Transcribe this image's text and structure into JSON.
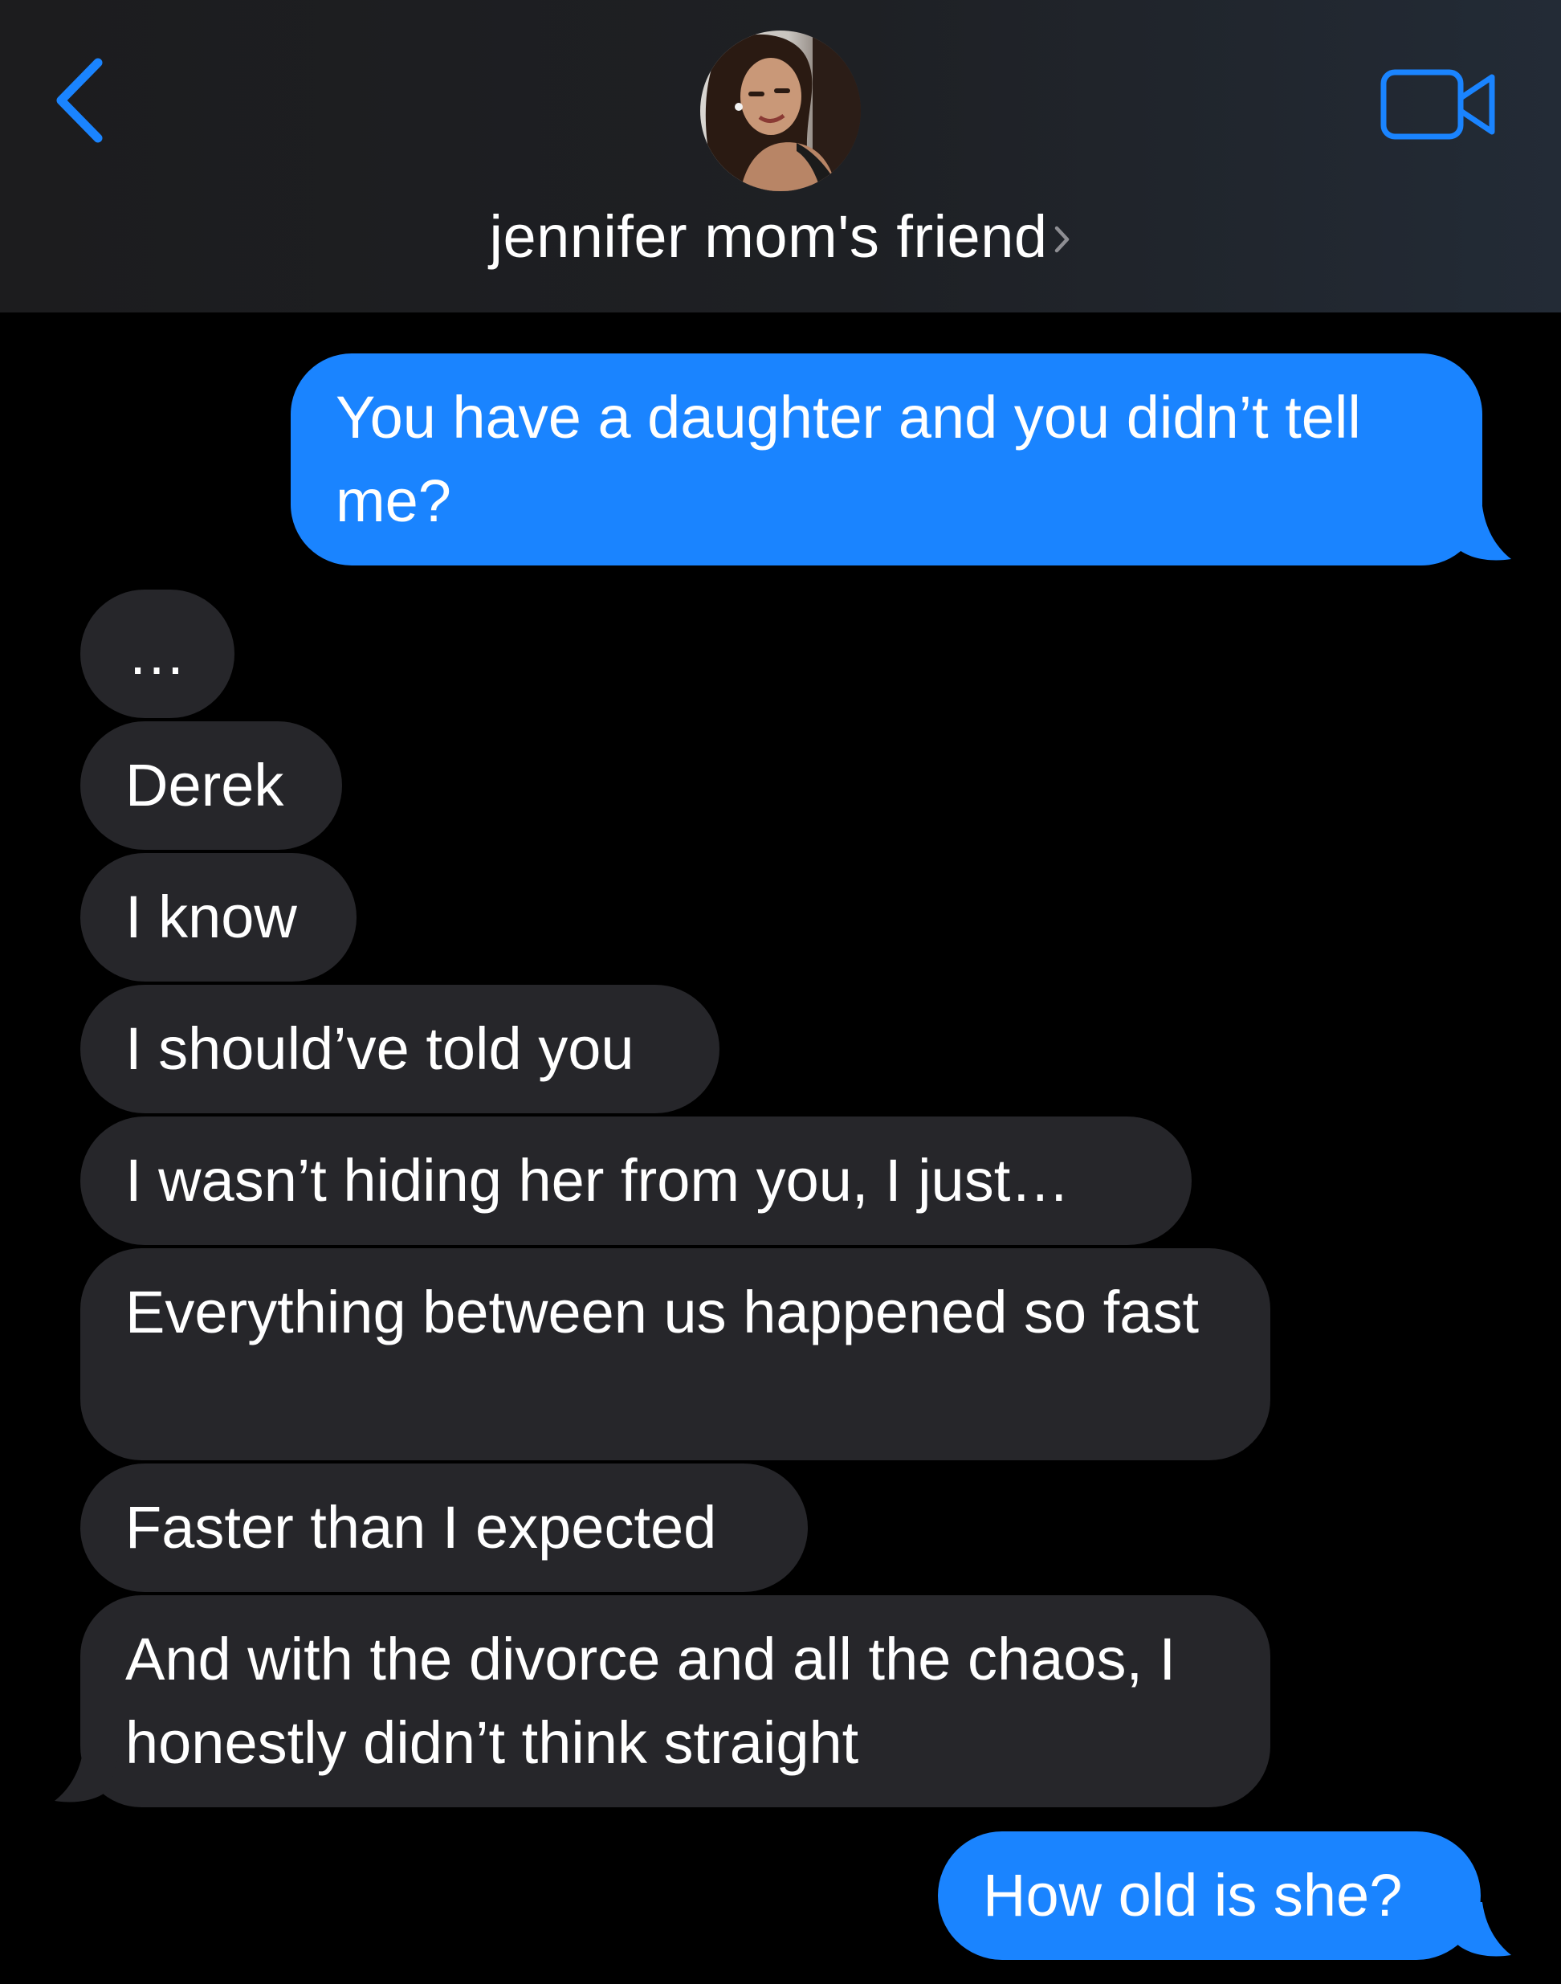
{
  "header": {
    "contact_name": "jennifer mom's friend",
    "back_icon": "chevron-left-icon",
    "video_icon": "video-camera-icon",
    "accent_color": "#1a84ff"
  },
  "messages": [
    {
      "direction": "outgoing",
      "text": "You have a daughter and you didn’t tell me?"
    },
    {
      "direction": "incoming",
      "text": "…"
    },
    {
      "direction": "incoming",
      "text": "Derek"
    },
    {
      "direction": "incoming",
      "text": "I know"
    },
    {
      "direction": "incoming",
      "text": "I should’ve told you"
    },
    {
      "direction": "incoming",
      "text": "I wasn’t hiding her from you, I just…"
    },
    {
      "direction": "incoming",
      "text": "Everything between us happened so fast"
    },
    {
      "direction": "incoming",
      "text": "Faster than I expected"
    },
    {
      "direction": "incoming",
      "text": "And with the divorce and all the chaos, I honestly didn’t think straight"
    },
    {
      "direction": "outgoing",
      "text": "How old is she?"
    }
  ],
  "colors": {
    "outgoing_bubble": "#1a84ff",
    "incoming_bubble": "#26262a",
    "background": "#000000"
  }
}
